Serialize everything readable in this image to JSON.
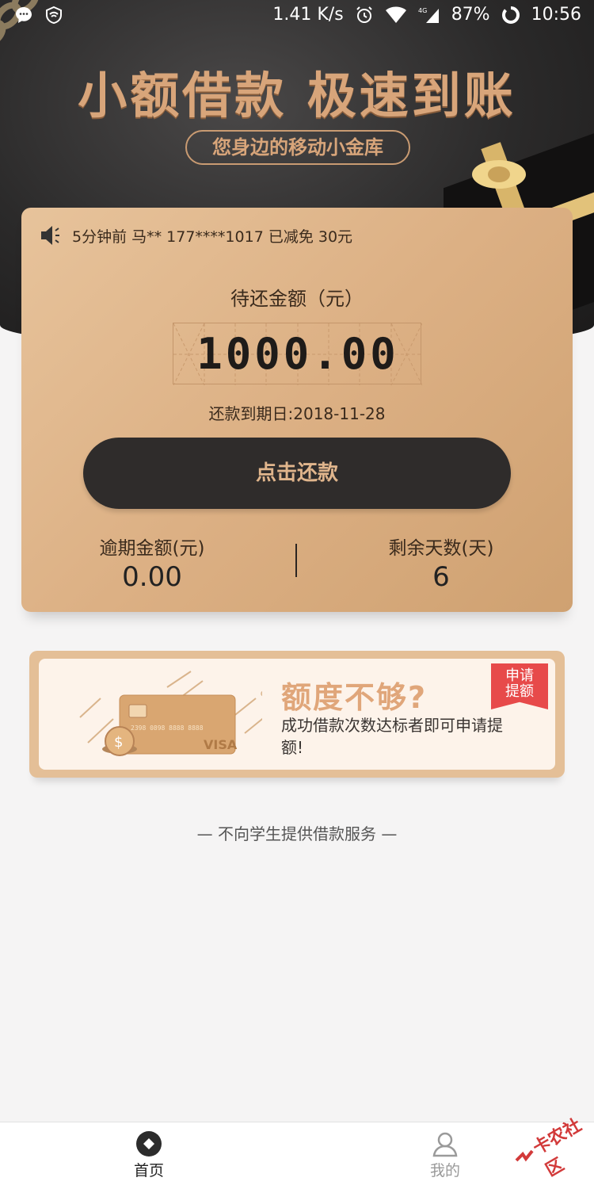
{
  "status_bar": {
    "network_speed": "1.41 K/s",
    "network_type": "4G",
    "battery": "87%",
    "time": "10:56",
    "icons": [
      "chat-icon",
      "shield-icon",
      "alarm-icon",
      "wifi-icon",
      "signal-icon",
      "battery-ring-icon"
    ]
  },
  "hero": {
    "headline": "小额借款 极速到账",
    "tagline": "您身边的移动小金库"
  },
  "card": {
    "notice": "5分钟前 马** 177****1017 已减免 30元",
    "notice_icon": "speaker-icon",
    "amount_label": "待还金额（元）",
    "amount": "1000.00",
    "due_date": "还款到期日:2018-11-28",
    "repay_button": "点击还款",
    "overdue_label": "逾期金额(元)",
    "overdue_value": "0.00",
    "remaining_label": "剩余天数(天)",
    "remaining_value": "6"
  },
  "promo": {
    "title": "额度不够?",
    "description": "成功借款次数达标者即可申请提额!",
    "badge_line1": "申请",
    "badge_line2": "提额",
    "card_number": "2398 0898 8888 8888",
    "card_brand": "VISA"
  },
  "footer_note": "— 不向学生提供借款服务 —",
  "tabbar": {
    "home_label": "首页",
    "me_label": "我的"
  },
  "watermark": "卡农社区",
  "colors": {
    "gold": "#dcb084",
    "dark": "#2f2c2b",
    "accent_text": "#e0a67a",
    "badge": "#e74a4a"
  }
}
